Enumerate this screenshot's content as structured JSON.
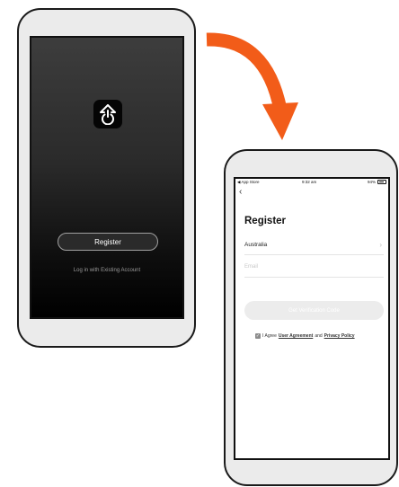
{
  "colors": {
    "arrow": "#f25c19",
    "phone_body": "#ebebeb"
  },
  "left_phone": {
    "app_icon": "power-icon",
    "register_label": "Register",
    "login_link": "Log in with Existing Account"
  },
  "right_phone": {
    "status_bar": {
      "back_app": "◀ App Store",
      "time": "9:32 am",
      "battery_percent": "94%"
    },
    "back_icon": "chevron-left-icon",
    "title": "Register",
    "country": "Australia",
    "email_placeholder": "Email",
    "verify_button": "Get Verification Code",
    "agree_prefix": "I Agree",
    "user_agreement": "User Agreement",
    "and_text": "and",
    "privacy_policy": "Privacy Policy"
  }
}
